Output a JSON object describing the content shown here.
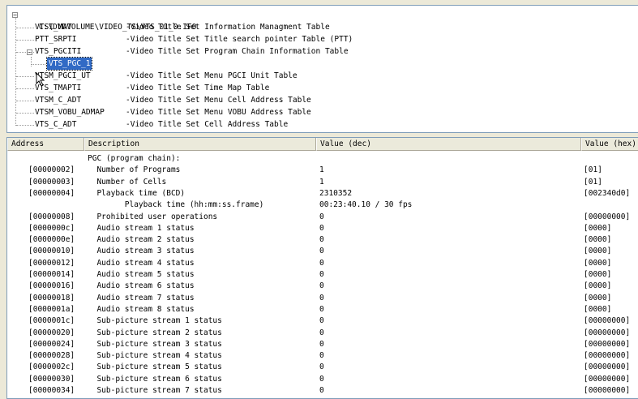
{
  "tree": {
    "root_label": "C:\\DVDVOLUME\\VIDEO_TS\\VTS_01_0.IFO",
    "items": [
      {
        "name": "VTSI_MAT",
        "desc": "-Video Title Set Information Managment Table"
      },
      {
        "name": "PTT_SRPTI",
        "desc": "-Video Title Set Title search pointer Table (PTT)"
      },
      {
        "name": "VTS_PGCITI",
        "desc": "-Video Title Set Program Chain Information Table"
      },
      {
        "name": "VTS_PGC_1",
        "desc": ""
      },
      {
        "name": "VTSM_PGCI_UT",
        "desc": "-Video Title Set Menu PGCI Unit Table"
      },
      {
        "name": "VTS_TMAPTI",
        "desc": "-Video Title Set Time Map Table"
      },
      {
        "name": "VTSM_C_ADT",
        "desc": "-Video Title Set Menu Cell Address Table"
      },
      {
        "name": "VTSM_VOBU_ADMAP",
        "desc": "-Video Title Set Menu VOBU Address Table"
      },
      {
        "name": "VTS_C_ADT",
        "desc": "-Video Title Set Cell Address Table"
      }
    ]
  },
  "grid": {
    "columns": [
      "Address",
      "Description",
      "Value (dec)",
      "Value (hex)"
    ],
    "rows": [
      {
        "addr": "",
        "desc": "PGC (program chain):",
        "dec": "",
        "hex": ""
      },
      {
        "addr": "[00000002]",
        "desc": "  Number of Programs",
        "dec": "1",
        "hex": "[01]"
      },
      {
        "addr": "[00000003]",
        "desc": "  Number of Cells",
        "dec": "1",
        "hex": "[01]"
      },
      {
        "addr": "[00000004]",
        "desc": "  Playback time (BCD)",
        "dec": "2310352",
        "hex": "[002340d0]"
      },
      {
        "addr": "",
        "desc": "        Playback time (hh:mm:ss.frame)",
        "dec": "00:23:40.10 / 30 fps",
        "hex": ""
      },
      {
        "addr": "[00000008]",
        "desc": "  Prohibited user operations",
        "dec": "0",
        "hex": "[00000000]"
      },
      {
        "addr": "[0000000c]",
        "desc": "  Audio stream 1 status",
        "dec": "0",
        "hex": "[0000]"
      },
      {
        "addr": "[0000000e]",
        "desc": "  Audio stream 2 status",
        "dec": "0",
        "hex": "[0000]"
      },
      {
        "addr": "[00000010]",
        "desc": "  Audio stream 3 status",
        "dec": "0",
        "hex": "[0000]"
      },
      {
        "addr": "[00000012]",
        "desc": "  Audio stream 4 status",
        "dec": "0",
        "hex": "[0000]"
      },
      {
        "addr": "[00000014]",
        "desc": "  Audio stream 5 status",
        "dec": "0",
        "hex": "[0000]"
      },
      {
        "addr": "[00000016]",
        "desc": "  Audio stream 6 status",
        "dec": "0",
        "hex": "[0000]"
      },
      {
        "addr": "[00000018]",
        "desc": "  Audio stream 7 status",
        "dec": "0",
        "hex": "[0000]"
      },
      {
        "addr": "[0000001a]",
        "desc": "  Audio stream 8 status",
        "dec": "0",
        "hex": "[0000]"
      },
      {
        "addr": "[0000001c]",
        "desc": "  Sub-picture stream 1 status",
        "dec": "0",
        "hex": "[00000000]"
      },
      {
        "addr": "[00000020]",
        "desc": "  Sub-picture stream 2 status",
        "dec": "0",
        "hex": "[00000000]"
      },
      {
        "addr": "[00000024]",
        "desc": "  Sub-picture stream 3 status",
        "dec": "0",
        "hex": "[00000000]"
      },
      {
        "addr": "[00000028]",
        "desc": "  Sub-picture stream 4 status",
        "dec": "0",
        "hex": "[00000000]"
      },
      {
        "addr": "[0000002c]",
        "desc": "  Sub-picture stream 5 status",
        "dec": "0",
        "hex": "[00000000]"
      },
      {
        "addr": "[00000030]",
        "desc": "  Sub-picture stream 6 status",
        "dec": "0",
        "hex": "[00000000]"
      },
      {
        "addr": "[00000034]",
        "desc": "  Sub-picture stream 7 status",
        "dec": "0",
        "hex": "[00000000]"
      }
    ]
  },
  "icons": {
    "expander_minus": "minus-box-icon",
    "cursor": "mouse-pointer-icon"
  },
  "colors": {
    "selection": "#316ac5",
    "header_bg": "#ebeadb",
    "panel_bg": "#ece9d8"
  }
}
